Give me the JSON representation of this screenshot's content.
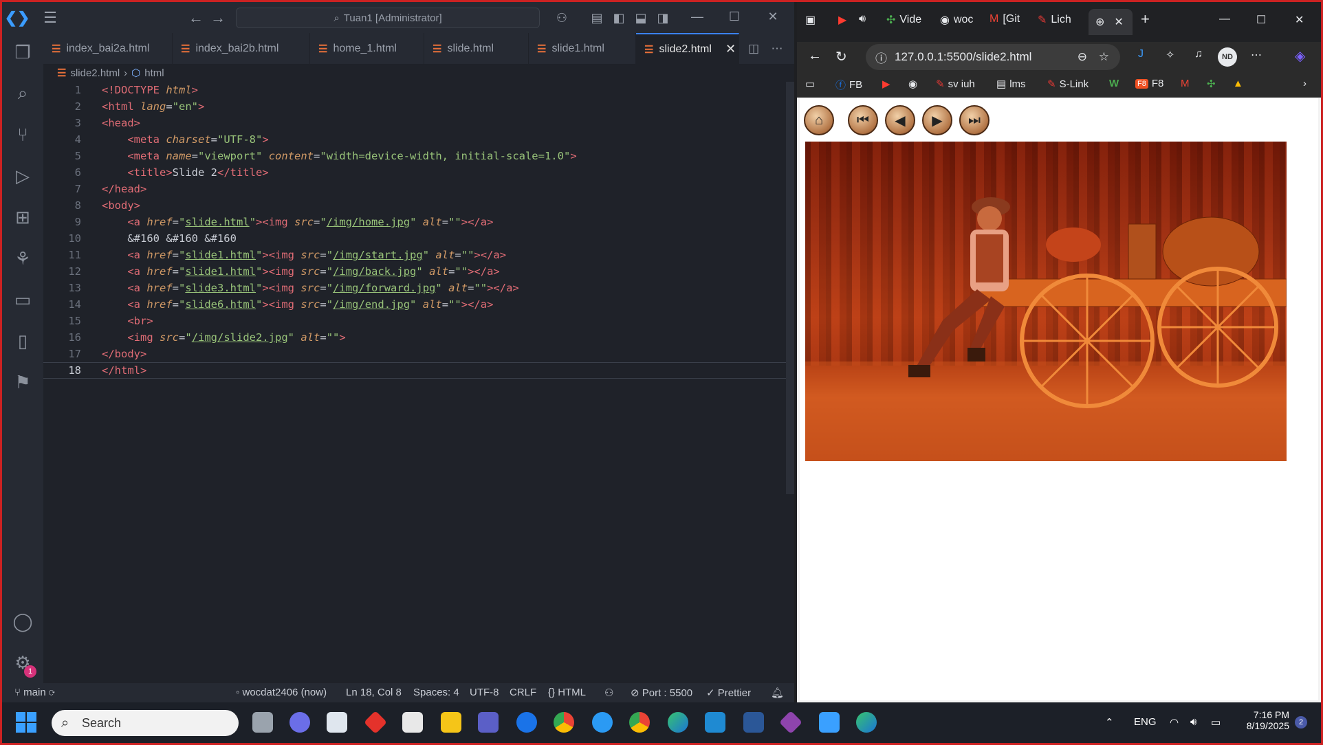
{
  "vscode": {
    "title_search": "Tuan1 [Administrator]",
    "tabs": [
      "index_bai2a.html",
      "index_bai2b.html",
      "home_1.html",
      "slide.html",
      "slide1.html",
      "slide2.html"
    ],
    "breadcrumb": {
      "file": "slide2.html",
      "symbol": "html"
    },
    "line_numbers": [
      "1",
      "2",
      "3",
      "4",
      "5",
      "6",
      "7",
      "8",
      "9",
      "10",
      "11",
      "12",
      "13",
      "14",
      "15",
      "16",
      "17",
      "18"
    ],
    "status": {
      "branch": "main",
      "user": "wocdat2406 (now)",
      "position": "Ln 18, Col 8",
      "spaces": "Spaces: 4",
      "encoding": "UTF-8",
      "eol": "CRLF",
      "language": "HTML",
      "port": "Port : 5500",
      "formatter": "Prettier"
    },
    "settings_badge": "1"
  },
  "browser": {
    "tabs": [
      "Vide",
      "woc",
      "[Git",
      "Lich"
    ],
    "url": "127.0.0.1:5500/slide2.html",
    "profile": "ND",
    "bookmarks": [
      "FB",
      "sv iuh",
      "lms",
      "S-Link",
      "F8"
    ]
  },
  "taskbar": {
    "search_placeholder": "Search",
    "language": "ENG",
    "time": "7:16 PM",
    "date": "8/19/2025",
    "notification_count": "2"
  }
}
